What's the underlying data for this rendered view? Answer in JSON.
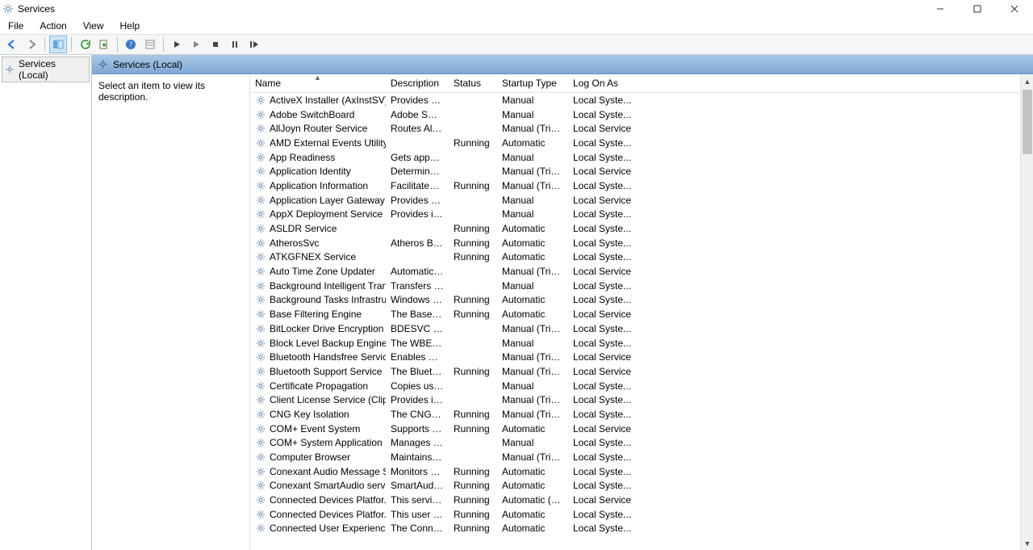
{
  "window": {
    "title": "Services"
  },
  "menubar": [
    "File",
    "Action",
    "View",
    "Help"
  ],
  "tree": {
    "root": "Services (Local)"
  },
  "pane": {
    "title": "Services (Local)"
  },
  "description_hint": "Select an item to view its description.",
  "columns": {
    "name": "Name",
    "description": "Description",
    "status": "Status",
    "startup": "Startup Type",
    "logon": "Log On As"
  },
  "services": [
    {
      "name": "ActiveX Installer (AxInstSV)",
      "desc": "Provides Us...",
      "status": "",
      "startup": "Manual",
      "logon": "Local Syste..."
    },
    {
      "name": "Adobe SwitchBoard",
      "desc": "Adobe Swit...",
      "status": "",
      "startup": "Manual",
      "logon": "Local Syste..."
    },
    {
      "name": "AllJoyn Router Service",
      "desc": "Routes AllJo...",
      "status": "",
      "startup": "Manual (Trig...",
      "logon": "Local Service"
    },
    {
      "name": "AMD External Events Utility",
      "desc": "",
      "status": "Running",
      "startup": "Automatic",
      "logon": "Local Syste..."
    },
    {
      "name": "App Readiness",
      "desc": "Gets apps re...",
      "status": "",
      "startup": "Manual",
      "logon": "Local Syste..."
    },
    {
      "name": "Application Identity",
      "desc": "Determines ...",
      "status": "",
      "startup": "Manual (Trig...",
      "logon": "Local Service"
    },
    {
      "name": "Application Information",
      "desc": "Facilitates t...",
      "status": "Running",
      "startup": "Manual (Trig...",
      "logon": "Local Syste..."
    },
    {
      "name": "Application Layer Gateway ...",
      "desc": "Provides su...",
      "status": "",
      "startup": "Manual",
      "logon": "Local Service"
    },
    {
      "name": "AppX Deployment Service (...",
      "desc": "Provides inf...",
      "status": "",
      "startup": "Manual",
      "logon": "Local Syste..."
    },
    {
      "name": "ASLDR Service",
      "desc": "",
      "status": "Running",
      "startup": "Automatic",
      "logon": "Local Syste..."
    },
    {
      "name": "AtherosSvc",
      "desc": "Atheros BT ...",
      "status": "Running",
      "startup": "Automatic",
      "logon": "Local Syste..."
    },
    {
      "name": "ATKGFNEX Service",
      "desc": "",
      "status": "Running",
      "startup": "Automatic",
      "logon": "Local Syste..."
    },
    {
      "name": "Auto Time Zone Updater",
      "desc": "Automatica...",
      "status": "",
      "startup": "Manual (Trig...",
      "logon": "Local Service"
    },
    {
      "name": "Background Intelligent Tran...",
      "desc": "Transfers fil...",
      "status": "",
      "startup": "Manual",
      "logon": "Local Syste..."
    },
    {
      "name": "Background Tasks Infrastru...",
      "desc": "Windows in...",
      "status": "Running",
      "startup": "Automatic",
      "logon": "Local Syste..."
    },
    {
      "name": "Base Filtering Engine",
      "desc": "The Base Fil...",
      "status": "Running",
      "startup": "Automatic",
      "logon": "Local Service"
    },
    {
      "name": "BitLocker Drive Encryption ...",
      "desc": "BDESVC hos...",
      "status": "",
      "startup": "Manual (Trig...",
      "logon": "Local Syste..."
    },
    {
      "name": "Block Level Backup Engine ...",
      "desc": "The WBENG...",
      "status": "",
      "startup": "Manual",
      "logon": "Local Syste..."
    },
    {
      "name": "Bluetooth Handsfree Service",
      "desc": "Enables wir...",
      "status": "",
      "startup": "Manual (Trig...",
      "logon": "Local Service"
    },
    {
      "name": "Bluetooth Support Service",
      "desc": "The Bluetoo...",
      "status": "Running",
      "startup": "Manual (Trig...",
      "logon": "Local Service"
    },
    {
      "name": "Certificate Propagation",
      "desc": "Copies user ...",
      "status": "",
      "startup": "Manual",
      "logon": "Local Syste..."
    },
    {
      "name": "Client License Service (ClipS...",
      "desc": "Provides inf...",
      "status": "",
      "startup": "Manual (Trig...",
      "logon": "Local Syste..."
    },
    {
      "name": "CNG Key Isolation",
      "desc": "The CNG ke...",
      "status": "Running",
      "startup": "Manual (Trig...",
      "logon": "Local Syste..."
    },
    {
      "name": "COM+ Event System",
      "desc": "Supports Sy...",
      "status": "Running",
      "startup": "Automatic",
      "logon": "Local Service"
    },
    {
      "name": "COM+ System Application",
      "desc": "Manages th...",
      "status": "",
      "startup": "Manual",
      "logon": "Local Syste..."
    },
    {
      "name": "Computer Browser",
      "desc": "Maintains a...",
      "status": "",
      "startup": "Manual (Trig...",
      "logon": "Local Syste..."
    },
    {
      "name": "Conexant Audio Message S...",
      "desc": "Monitors au...",
      "status": "Running",
      "startup": "Automatic",
      "logon": "Local Syste..."
    },
    {
      "name": "Conexant SmartAudio service",
      "desc": "SmartAudio...",
      "status": "Running",
      "startup": "Automatic",
      "logon": "Local Syste..."
    },
    {
      "name": "Connected Devices Platfor...",
      "desc": "This service ...",
      "status": "Running",
      "startup": "Automatic (D...",
      "logon": "Local Service"
    },
    {
      "name": "Connected Devices Platfor...",
      "desc": "This user se...",
      "status": "Running",
      "startup": "Automatic",
      "logon": "Local Syste..."
    },
    {
      "name": "Connected User Experience...",
      "desc": "The Connec...",
      "status": "Running",
      "startup": "Automatic",
      "logon": "Local Syste..."
    }
  ]
}
